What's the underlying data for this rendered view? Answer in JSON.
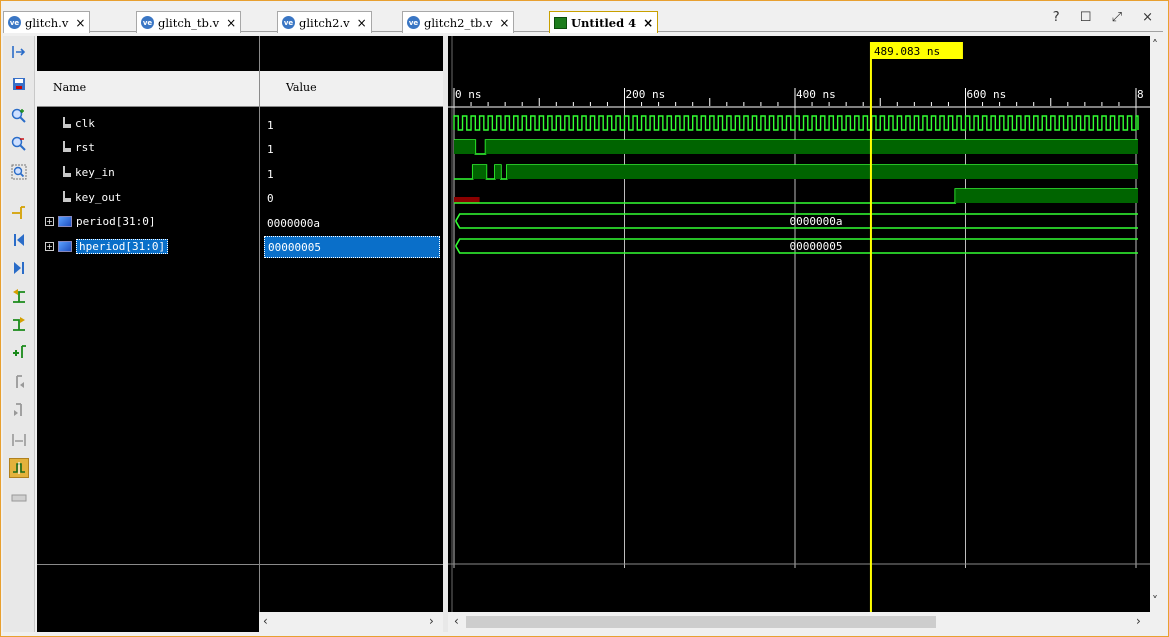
{
  "tabs": [
    {
      "label": "glitch.v",
      "icon": "verilog-file-icon"
    },
    {
      "label": "glitch_tb.v",
      "icon": "verilog-file-icon"
    },
    {
      "label": "glitch2.v",
      "icon": "verilog-file-icon"
    },
    {
      "label": "glitch2_tb.v",
      "icon": "verilog-file-icon"
    },
    {
      "label": "Untitled 4",
      "icon": "waveform-icon",
      "active": true
    }
  ],
  "tab_icon_text": "ve",
  "close_glyph": "×",
  "window_controls": "? ☐ ⤢ ×",
  "columns": {
    "name": "Name",
    "value": "Value"
  },
  "signals": [
    {
      "name": "clk",
      "value": "1",
      "type": "wire"
    },
    {
      "name": "rst",
      "value": "1",
      "type": "wire"
    },
    {
      "name": "key_in",
      "value": "1",
      "type": "wire"
    },
    {
      "name": "key_out",
      "value": "0",
      "type": "wire"
    },
    {
      "name": "period[31:0]",
      "value": "0000000a",
      "type": "bus",
      "bus_label": "0000000a"
    },
    {
      "name": "hperiod[31:0]",
      "value": "00000005",
      "type": "bus",
      "bus_label": "00000005",
      "selected": true
    }
  ],
  "cursor": {
    "label": "489.083 ns",
    "time_ns": 489.083
  },
  "timeline": {
    "ticks": [
      "0 ns",
      "200 ns",
      "400 ns",
      "600 ns",
      "8"
    ],
    "start_ns": 0,
    "ns_per_major": 200
  },
  "colors": {
    "wave_green": "#33ff33",
    "bus_fill": "#006400",
    "cursor": "#ffff00",
    "selection": "#0a6fc9",
    "unknown_red": "#8b0000"
  },
  "toolbar_icons": [
    "zoom-fit-icon",
    "save-icon",
    "zoom-in-icon",
    "zoom-out-icon",
    "zoom-full-icon",
    "go-to-cursor-icon",
    "go-to-time-zero-icon",
    "go-to-last-time-icon",
    "previous-transition-icon",
    "next-transition-icon",
    "add-marker-icon",
    "previous-marker-icon",
    "next-marker-icon",
    "swap-cursors-icon",
    "snap-to-transition-icon",
    "floating-ruler-icon"
  ]
}
